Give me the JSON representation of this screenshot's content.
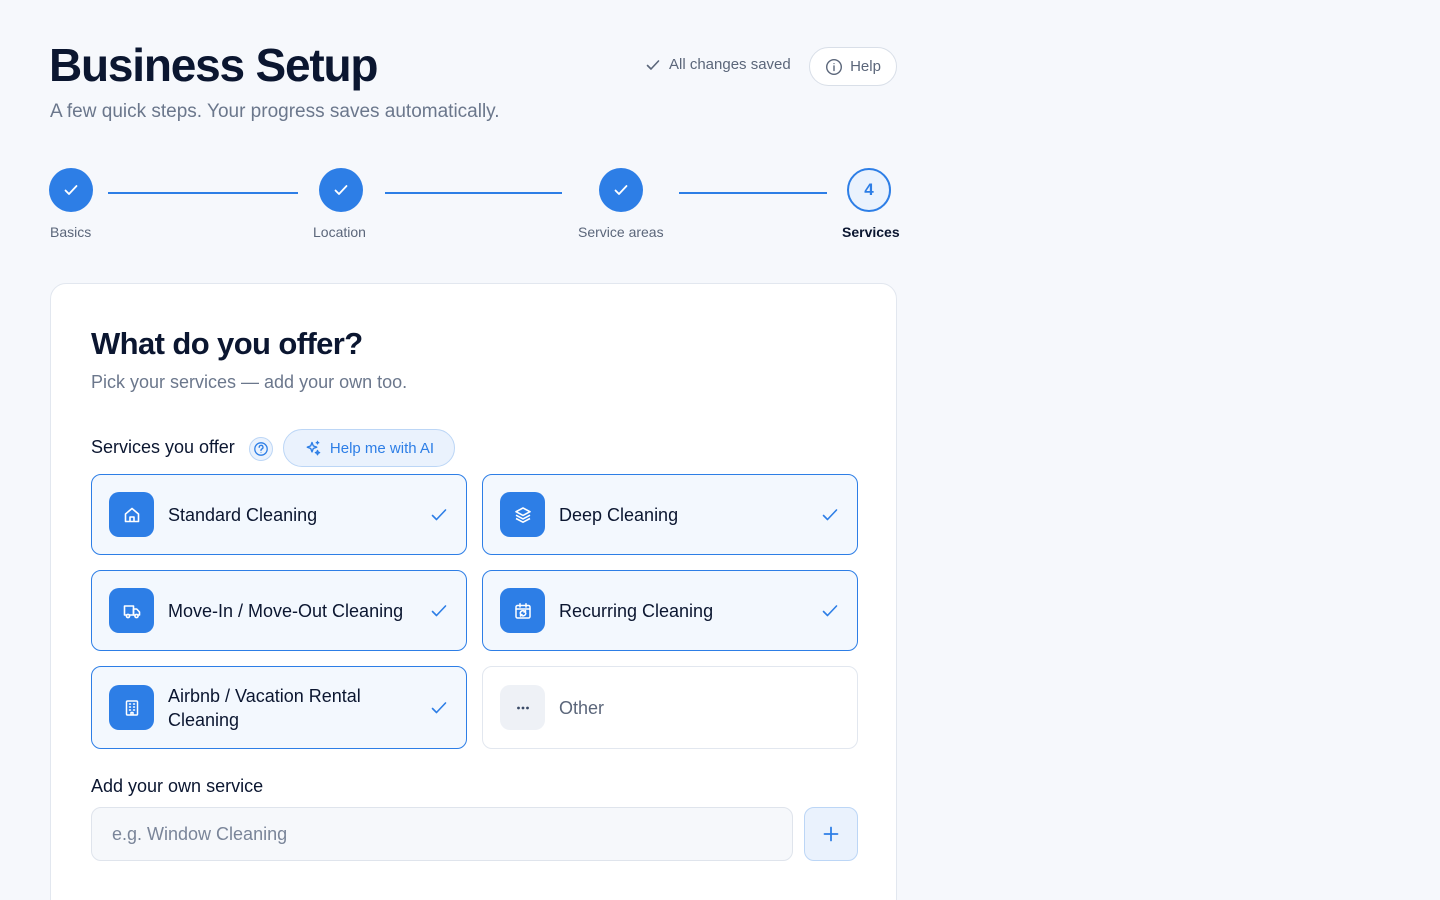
{
  "header": {
    "title": "Business Setup",
    "subtitle": "A few quick steps. Your progress saves automatically.",
    "status": "All changes saved",
    "help_label": "Help"
  },
  "stepper": {
    "steps": [
      {
        "label": "Basics",
        "state": "done"
      },
      {
        "label": "Location",
        "state": "done"
      },
      {
        "label": "Service areas",
        "state": "done"
      },
      {
        "label": "Services",
        "state": "current",
        "number": "4"
      }
    ]
  },
  "card": {
    "title": "What do you offer?",
    "subtitle": "Pick your services — add your own too.",
    "services_label": "Services you offer",
    "ai_button": "Help me with AI",
    "services": [
      {
        "label": "Standard Cleaning",
        "icon": "home-icon",
        "selected": true
      },
      {
        "label": "Deep Cleaning",
        "icon": "layers-icon",
        "selected": true
      },
      {
        "label": "Move-In / Move-Out Cleaning",
        "icon": "truck-icon",
        "selected": true
      },
      {
        "label": "Recurring Cleaning",
        "icon": "calendar-repeat-icon",
        "selected": true
      },
      {
        "label": "Airbnb / Vacation Rental Cleaning",
        "icon": "building-icon",
        "selected": true
      },
      {
        "label": "Other",
        "icon": "more-icon",
        "selected": false
      }
    ],
    "add_label": "Add your own service",
    "add_placeholder": "e.g. Window Cleaning",
    "add_value": ""
  },
  "colors": {
    "accent": "#2d7ee6",
    "background": "#f6f8fc",
    "text": "#0b1630",
    "muted": "#6b778c"
  }
}
